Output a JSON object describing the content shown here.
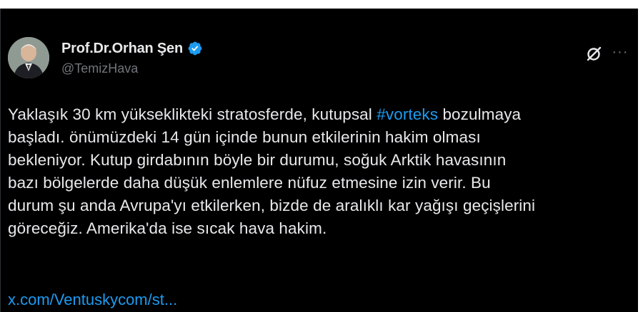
{
  "post": {
    "author": {
      "display_name": "Prof.Dr.Orhan Şen",
      "handle": "@TemizHava",
      "verified": true
    },
    "text_lines": [
      [
        "Yaklaşık 30 km yükseklikteki stratosferde, kutupsal ",
        "#vorteks",
        " bozulmaya"
      ],
      "başladı. önümüzdeki 14 gün içinde bunun etkilerinin hakim olması",
      "bekleniyor. Kutup girdabının böyle bir durumu, soğuk Arktik havasının",
      "bazı bölgelerde daha düşük enlemlere nüfuz etmesine izin verir. Bu",
      "durum şu anda Avrupa'yı etkilerken, bizde de aralıklı kar yağışı geçişlerini",
      "göreceğiz. Amerika'da ise sıcak hava hakim."
    ],
    "line1_before": "Yaklaşık 30 km yükseklikteki stratosferde, kutupsal ",
    "hashtag": "#vorteks",
    "line1_after": " bozulmaya",
    "line2": "başladı. önümüzdeki 14 gün içinde bunun etkilerinin hakim olması",
    "line3": "bekleniyor. Kutup girdabının böyle bir durumu, soğuk Arktik havasının",
    "line4": "bazı bölgelerde daha düşük enlemlere nüfuz etmesine izin verir. Bu",
    "line5": "durum şu anda Avrupa'yı etkilerken, bizde de aralıklı kar yağışı geçişlerini",
    "line6": "göreceğiz. Amerika'da ise sıcak hava hakim.",
    "link_text": "x.com/Ventuskycom/st...",
    "more_label": "···"
  },
  "icons": {
    "verified": "verified-badge-icon",
    "grok": "grok-icon",
    "more": "more-icon"
  },
  "colors": {
    "background": "#000000",
    "text": "#e7e9ea",
    "secondary": "#71767b",
    "accent": "#1d9bf0"
  }
}
